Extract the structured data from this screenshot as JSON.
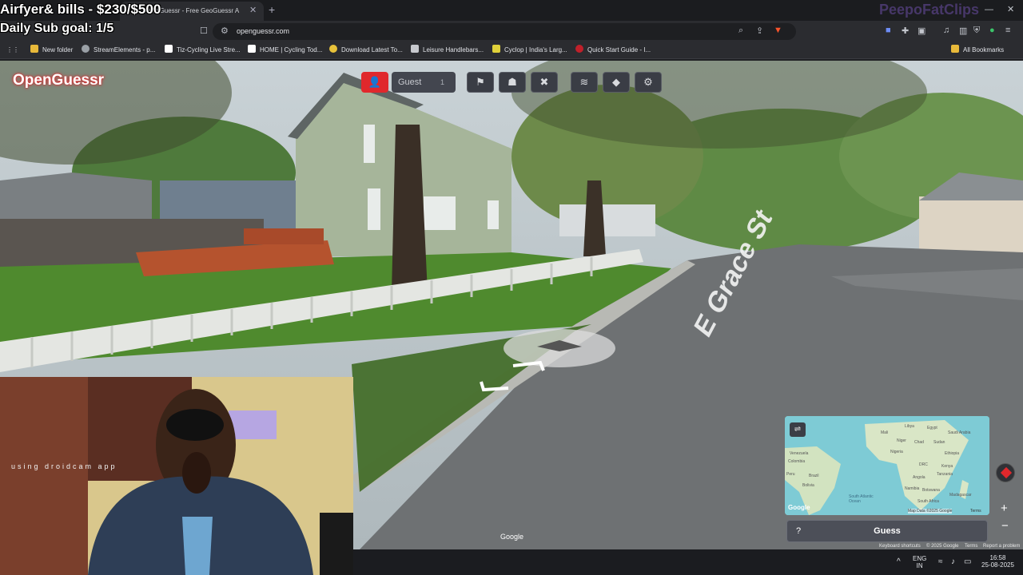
{
  "overlay": {
    "line1": "Airfyer& bills - $230/$500",
    "line2": "Daily Sub goal: 1/5",
    "watermark": "PeepoFatClips",
    "webcam_caption": "using droidcam app"
  },
  "browser": {
    "tab_title": "OpenGuessr - Free GeoGuessr A",
    "url": "openguessr.com",
    "bookmarks": [
      {
        "label": "New folder",
        "color": "#e8b93a"
      },
      {
        "label": "StreamElements - p...",
        "color": "#9aa0a6"
      },
      {
        "label": "Tiz-Cycling Live Stre...",
        "color": "#ffffff"
      },
      {
        "label": "HOME | Cycling Tod...",
        "color": "#ffffff"
      },
      {
        "label": "Download Latest To...",
        "color": "#e8c23a"
      },
      {
        "label": "Leisure Handlebars...",
        "color": "#c7c9ce"
      },
      {
        "label": "Cyclop | India's Larg...",
        "color": "#e0d13a"
      },
      {
        "label": "Quick Start Guide - I...",
        "color": "#c0202a"
      }
    ],
    "all_bookmarks": "All Bookmarks"
  },
  "game": {
    "brand": "OpenGuessr",
    "player": "Guest",
    "player_count": "1",
    "street_sign": "E Grace St",
    "guess_label": "Guess",
    "help_label": "?",
    "google_mark": "Google",
    "map_labels": [
      "Mali",
      "Libya",
      "Egypt",
      "Saudi Arabia",
      "Niger",
      "Chad",
      "Sudan",
      "Nigeria",
      "Ethiopia",
      "DRC",
      "Kenya",
      "Tanzania",
      "Angola",
      "Namibia",
      "Botswana",
      "South Africa",
      "Madagascar",
      "Venezuela",
      "Colombia",
      "Peru",
      "Brazil",
      "Bolivia",
      "South Atlantic Ocean"
    ],
    "map_attrib": "Map Data ©2025 Google",
    "map_terms": "Terms",
    "map_google": "Google",
    "attrib_shortcuts": "Keyboard shortcuts",
    "attrib_google": "© 2025 Google",
    "attrib_terms": "Terms",
    "attrib_report": "Report a problem"
  },
  "taskbar": {
    "lang1": "ENG",
    "lang2": "IN",
    "time": "16:58",
    "date": "25-08-2025"
  },
  "colors": {
    "accent": "#e0282c",
    "chrome_bg": "#2b2c30"
  }
}
